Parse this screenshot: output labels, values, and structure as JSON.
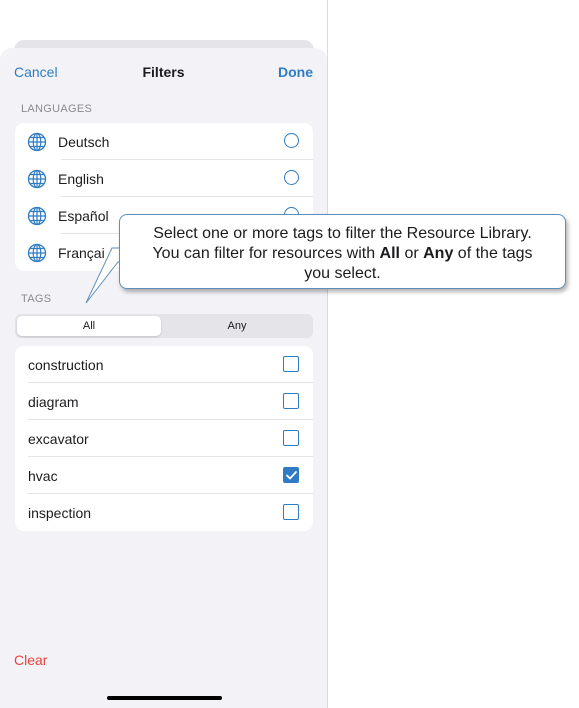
{
  "nav": {
    "cancel": "Cancel",
    "title": "Filters",
    "done": "Done"
  },
  "languages": {
    "header": "LANGUAGES",
    "items": [
      {
        "label": "Deutsch",
        "selected": false
      },
      {
        "label": "English",
        "selected": false
      },
      {
        "label": "Español",
        "selected": false
      },
      {
        "label": "Françai",
        "selected": false
      }
    ]
  },
  "tags": {
    "header": "TAGS",
    "mode_all": "All",
    "mode_any": "Any",
    "selected_mode": "All",
    "items": [
      {
        "label": "construction",
        "checked": false
      },
      {
        "label": "diagram",
        "checked": false
      },
      {
        "label": "excavator",
        "checked": false
      },
      {
        "label": "hvac",
        "checked": true
      },
      {
        "label": "inspection",
        "checked": false
      }
    ]
  },
  "clear": "Clear",
  "callout": {
    "line1": "Select one or more tags to filter the Resource Library.",
    "line2_pre": "You can filter for resources with ",
    "line2_all": "All",
    "line2_mid": " or ",
    "line2_any": "Any",
    "line2_post": " of the tags",
    "line3": "you select."
  },
  "colors": {
    "accent": "#2f7cc4",
    "destructive": "#e8453c",
    "sheet_bg": "#f2f2f7",
    "callout_border": "#5f8fb8"
  }
}
